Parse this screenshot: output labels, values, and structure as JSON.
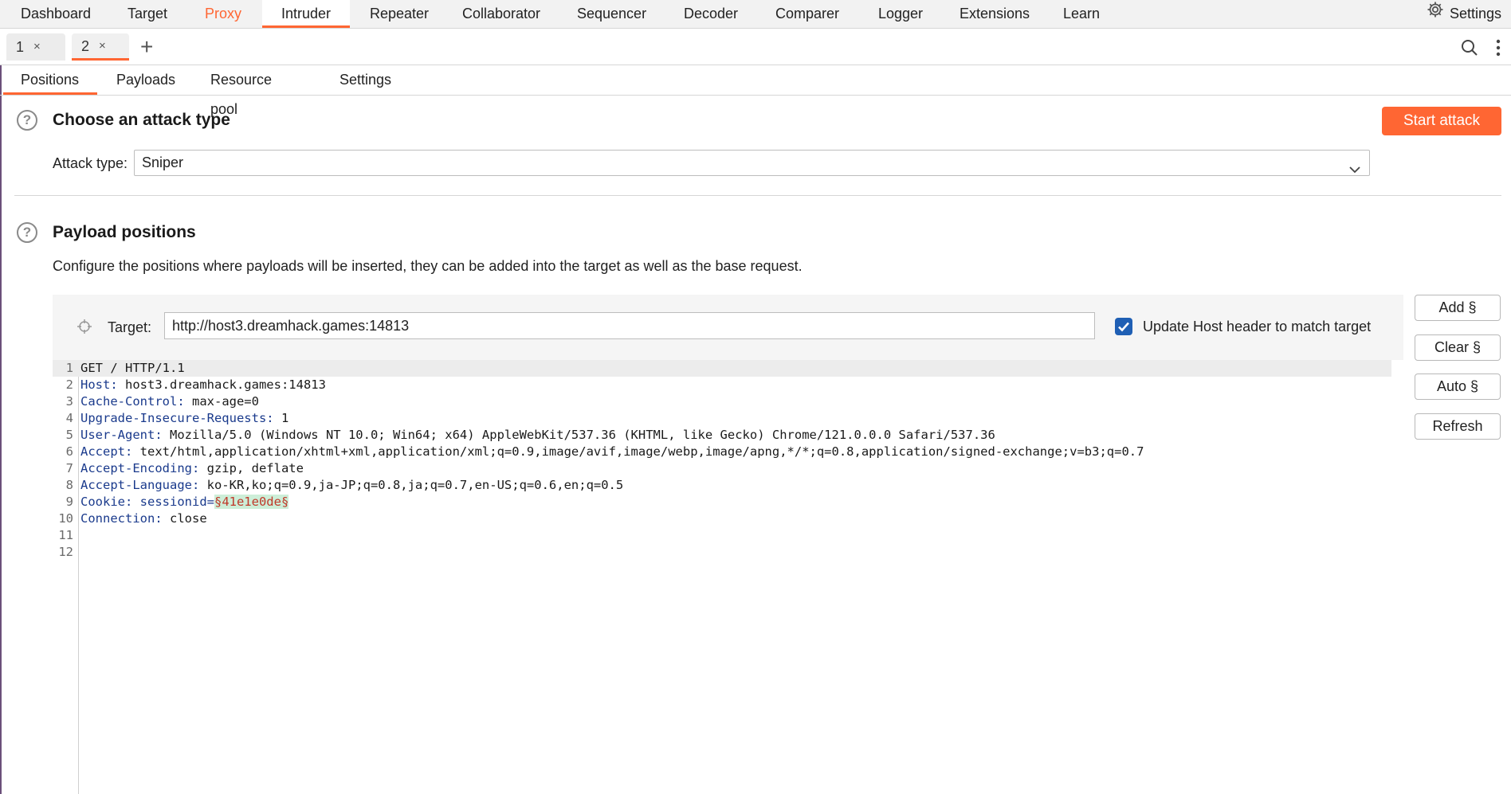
{
  "topnav": {
    "tabs": [
      "Dashboard",
      "Target",
      "Proxy",
      "Intruder",
      "Repeater",
      "Collaborator",
      "Sequencer",
      "Decoder",
      "Comparer",
      "Logger",
      "Extensions",
      "Learn"
    ],
    "settings_label": "Settings"
  },
  "instance_tabs": [
    {
      "label": "1",
      "close": "×"
    },
    {
      "label": "2",
      "close": "×"
    }
  ],
  "add_tab_label": "+",
  "subtabs": [
    "Positions",
    "Payloads",
    "Resource pool",
    "Settings"
  ],
  "attack": {
    "title": "Choose an attack type",
    "start_label": "Start attack",
    "type_label": "Attack type:",
    "type_value": "Sniper"
  },
  "positions": {
    "title": "Payload positions",
    "description": "Configure the positions where payloads will be inserted, they can be added into the target as well as the base request.",
    "target_label": "Target:",
    "target_value": "http://host3.dreamhack.games:14813",
    "update_host_label": "Update Host header to match target",
    "update_host_checked": true
  },
  "request_lines": [
    {
      "n": "1",
      "key": "",
      "val": "GET / HTTP/1.1"
    },
    {
      "n": "2",
      "key": "Host:",
      "val": " host3.dreamhack.games:14813"
    },
    {
      "n": "3",
      "key": "Cache-Control:",
      "val": " max-age=0"
    },
    {
      "n": "4",
      "key": "Upgrade-Insecure-Requests:",
      "val": " 1"
    },
    {
      "n": "5",
      "key": "User-Agent:",
      "val": " Mozilla/5.0 (Windows NT 10.0; Win64; x64) AppleWebKit/537.36 (KHTML, like Gecko) Chrome/121.0.0.0 Safari/537.36"
    },
    {
      "n": "6",
      "key": "Accept:",
      "val": " text/html,application/xhtml+xml,application/xml;q=0.9,image/avif,image/webp,image/apng,*/*;q=0.8,application/signed-exchange;v=b3;q=0.7"
    },
    {
      "n": "7",
      "key": "Accept-Encoding:",
      "val": " gzip, deflate"
    },
    {
      "n": "8",
      "key": "Accept-Language:",
      "val": " ko-KR,ko;q=0.9,ja-JP;q=0.8,ja;q=0.7,en-US;q=0.6,en;q=0.5"
    },
    {
      "n": "9",
      "key": "Cookie:",
      "val": " sessionid=",
      "payload": "§41e1e0de§"
    },
    {
      "n": "10",
      "key": "Connection:",
      "val": " close"
    },
    {
      "n": "11",
      "key": "",
      "val": ""
    },
    {
      "n": "12",
      "key": "",
      "val": ""
    }
  ],
  "side_buttons": [
    "Add §",
    "Clear §",
    "Auto §",
    "Refresh"
  ],
  "colors": {
    "accent": "#ff6633",
    "checkbox": "#1f5fb4",
    "header_key": "#1a3a8c",
    "payload_text": "#c0392b",
    "payload_bg": "#cdeed8"
  }
}
